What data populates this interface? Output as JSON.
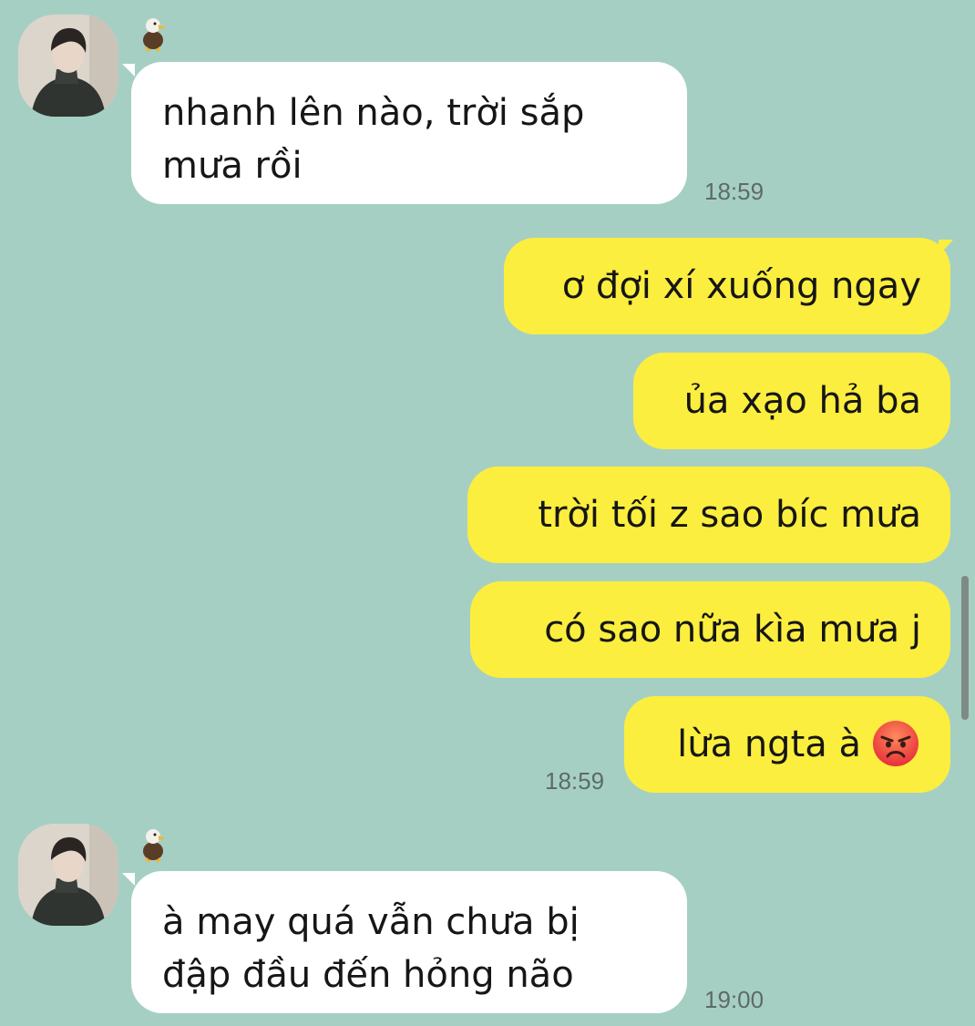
{
  "conversation": {
    "messages": [
      {
        "sender": "other",
        "text": "nhanh lên nào, trời sắp mưa rồi",
        "lines": [
          "nhanh lên nào, trời sắp",
          "mưa rồi"
        ],
        "time": "18:59"
      },
      {
        "sender": "me",
        "group": [
          "ơ đợi xí xuống ngay",
          "ủa xạo hả ba",
          "trời tối z sao bíc mưa",
          "có sao nữa kìa mưa j",
          "lừa ngta à"
        ],
        "last_emoji": "angry-face",
        "time": "18:59"
      },
      {
        "sender": "other",
        "text": "à may quá vẫn chưa bị đập đầu đến hỏng não",
        "lines": [
          "à may quá vẫn chưa bị",
          "đập đầu đến hỏng não"
        ],
        "time": "19:00"
      }
    ]
  },
  "colors": {
    "background": "#a6cfc4",
    "incoming_bubble": "#ffffff",
    "outgoing_bubble": "#fcee3e",
    "timestamp": "#5e6b66"
  },
  "icons": {
    "contact_avatar": "avatar-photo",
    "contact_badge": "eagle-icon",
    "reaction_emoji": "angry-face-icon"
  }
}
